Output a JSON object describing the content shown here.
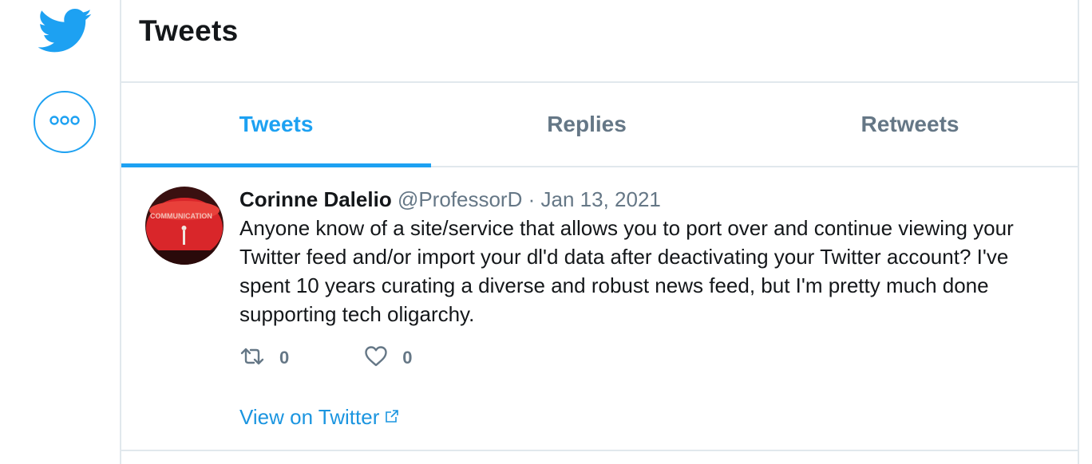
{
  "sidebar": {
    "logo_icon": "twitter-bird-icon",
    "more_icon": "more-dots-icon"
  },
  "header": {
    "title": "Tweets"
  },
  "tabs": [
    {
      "label": "Tweets",
      "active": true
    },
    {
      "label": "Replies",
      "active": false
    },
    {
      "label": "Retweets",
      "active": false
    }
  ],
  "tweet": {
    "author_name": "Corinne Dalelio",
    "handle": "@ProfessorD",
    "separator": "·",
    "date": "Jan 13, 2021",
    "text": "Anyone know of a site/service that allows you to port over and continue viewing your Twitter feed and/or import your dl'd data after deactivating your Twitter account? I've spent 10 years curating a diverse and robust news feed, but I'm pretty much done supporting tech oligarchy.",
    "avatar_text": "COMMUNICATION",
    "retweet_count": "0",
    "like_count": "0",
    "view_link_label": "View on Twitter"
  },
  "colors": {
    "accent": "#1da1f2",
    "text_primary": "#14171a",
    "text_secondary": "#657786",
    "border": "#e1e8ed",
    "avatar_red": "#d9262a"
  }
}
